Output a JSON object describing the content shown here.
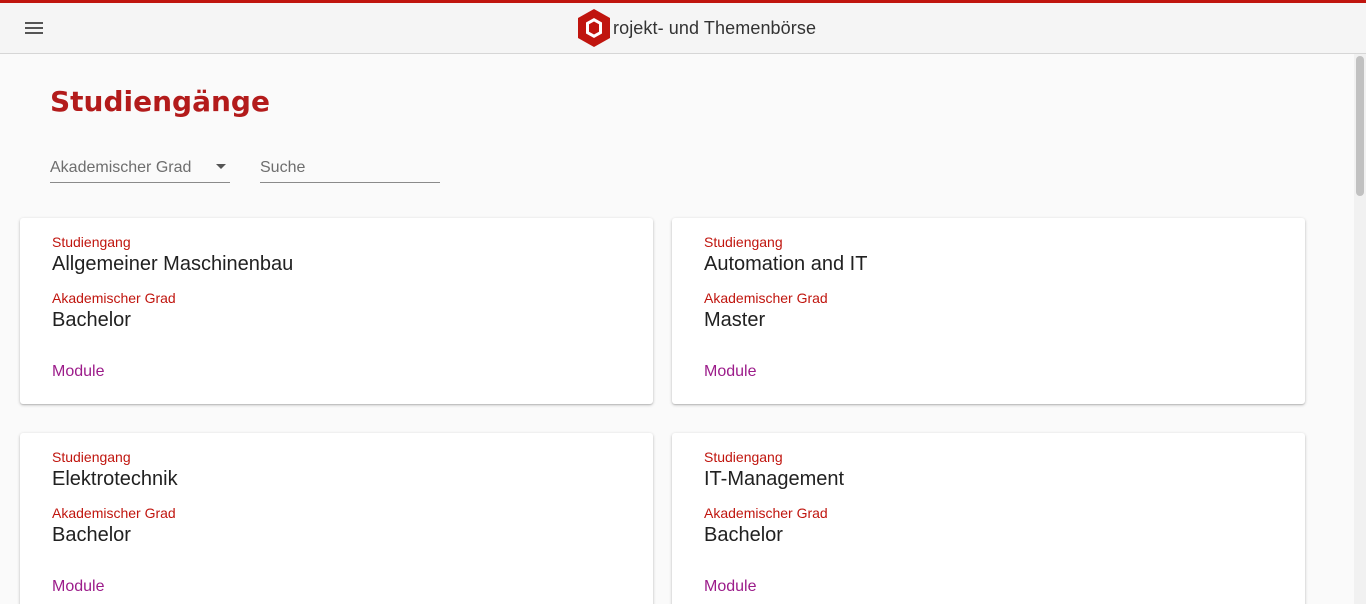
{
  "header": {
    "menu_icon": "hamburger-menu-icon",
    "logo_icon": "hexagon-logo-icon",
    "brand_text": "rojekt- und Themenbörse",
    "accent_color": "#c0150e"
  },
  "page": {
    "title": "Studiengänge"
  },
  "filters": {
    "degree_label": "Akademischer Grad",
    "search_placeholder": "Suche"
  },
  "cards": [
    {
      "program_label": "Studiengang",
      "program": "Allgemeiner Maschinenbau",
      "degree_label": "Akademischer Grad",
      "degree": "Bachelor",
      "link": "Module"
    },
    {
      "program_label": "Studiengang",
      "program": "Automation and IT",
      "degree_label": "Akademischer Grad",
      "degree": "Master",
      "link": "Module"
    },
    {
      "program_label": "Studiengang",
      "program": "Elektrotechnik",
      "degree_label": "Akademischer Grad",
      "degree": "Bachelor",
      "link": "Module"
    },
    {
      "program_label": "Studiengang",
      "program": "IT-Management",
      "degree_label": "Akademischer Grad",
      "degree": "Bachelor",
      "link": "Module"
    }
  ]
}
